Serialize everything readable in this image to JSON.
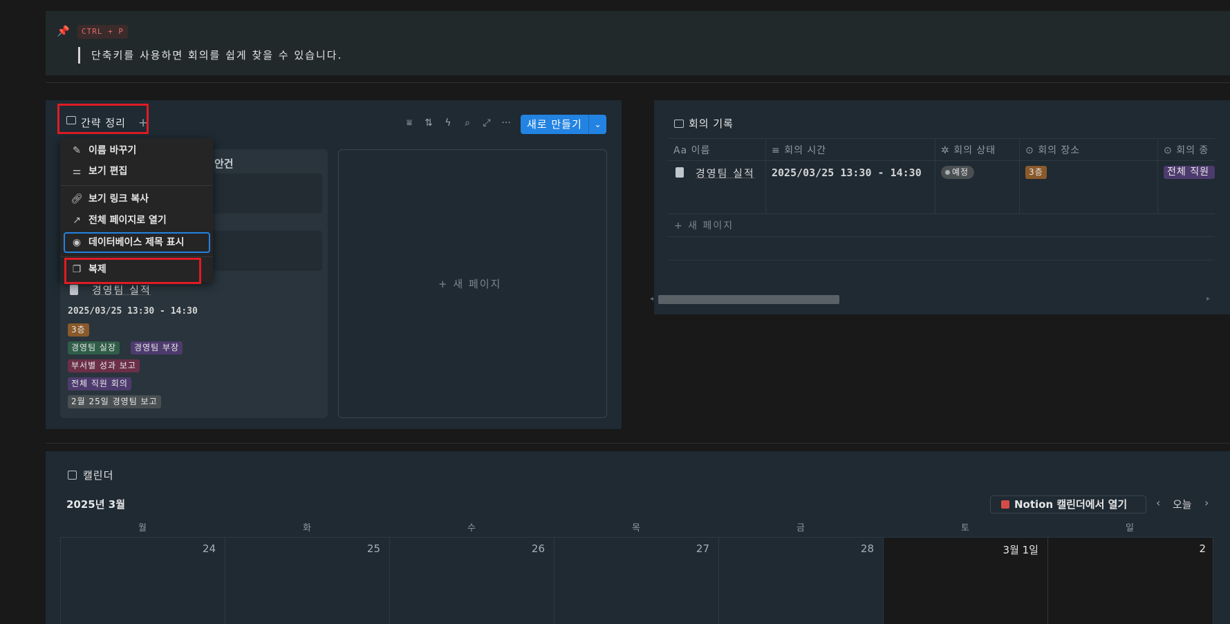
{
  "callout": {
    "icon": "pin-icon",
    "shortcut": "CTRL + P",
    "text": "단축키를 사용하면 회의를 쉽게 찾을 수 있습니다."
  },
  "board": {
    "view_tab": "간략 정리",
    "add_view": "+",
    "toolbar": {
      "filter": "⩸",
      "sort": "⇅",
      "automation": "ϟ",
      "search": "⌕",
      "expand": "⤢",
      "more": "···"
    },
    "new_button": "새로 만들기",
    "new_button_caret": "⌄",
    "column_header": "안건",
    "card": {
      "title": "경영팀 실적",
      "time": "2025/03/25 13:30 - 14:30",
      "floor": "3층",
      "tags": [
        "경영팀 실장",
        "경영팀 부장"
      ],
      "topic": "부서별 성과 보고",
      "type": "전체 직원 회의",
      "relation": "2월 25일 경영팀 보고"
    },
    "add_page": "+ 새 페이지"
  },
  "menu": {
    "items": [
      {
        "icon": "edit-icon",
        "label": "이름 바꾸기"
      },
      {
        "icon": "sliders-icon",
        "label": "보기 편집"
      },
      {
        "icon": "link-icon",
        "label": "보기 링크 복사"
      },
      {
        "icon": "arrow-up-right-icon",
        "label": "전체 페이지로 열기"
      },
      {
        "icon": "eye-icon",
        "label": "데이터베이스 제목 표시"
      },
      {
        "icon": "duplicate-icon",
        "label": "복제"
      }
    ]
  },
  "table": {
    "title": "회의 기록",
    "columns": [
      {
        "icon": "Aa",
        "label": "이름"
      },
      {
        "icon": "text-icon",
        "label": "회의 시간"
      },
      {
        "icon": "status-icon",
        "label": "회의 상태"
      },
      {
        "icon": "select-icon",
        "label": "회의 장소"
      },
      {
        "icon": "select-icon",
        "label": "회의 종"
      }
    ],
    "rows": [
      {
        "name": "경영팀 실적",
        "time": "2025/03/25 13:30 - 14:30",
        "status": "예정",
        "place": "3층",
        "type": "전체 직원"
      }
    ],
    "add_page": "+ 새 페이지"
  },
  "calendar": {
    "title": "캘린더",
    "month": "2025년 3월",
    "open_in": "Notion 캘린더에서 열기",
    "today": "오늘",
    "weekdays": [
      "월",
      "화",
      "수",
      "목",
      "금",
      "토",
      "일"
    ],
    "days": [
      "24",
      "25",
      "26",
      "27",
      "28",
      "3월 1일",
      "2"
    ]
  },
  "colors": {
    "accent": "#2383e2",
    "highlight": "#e01b24",
    "tag_brown": "#8a5a2b",
    "tag_green": "#2f5d48",
    "tag_purple": "#4d3b6e",
    "tag_red": "#6b2f48",
    "tag_gray": "#4a4f52"
  }
}
